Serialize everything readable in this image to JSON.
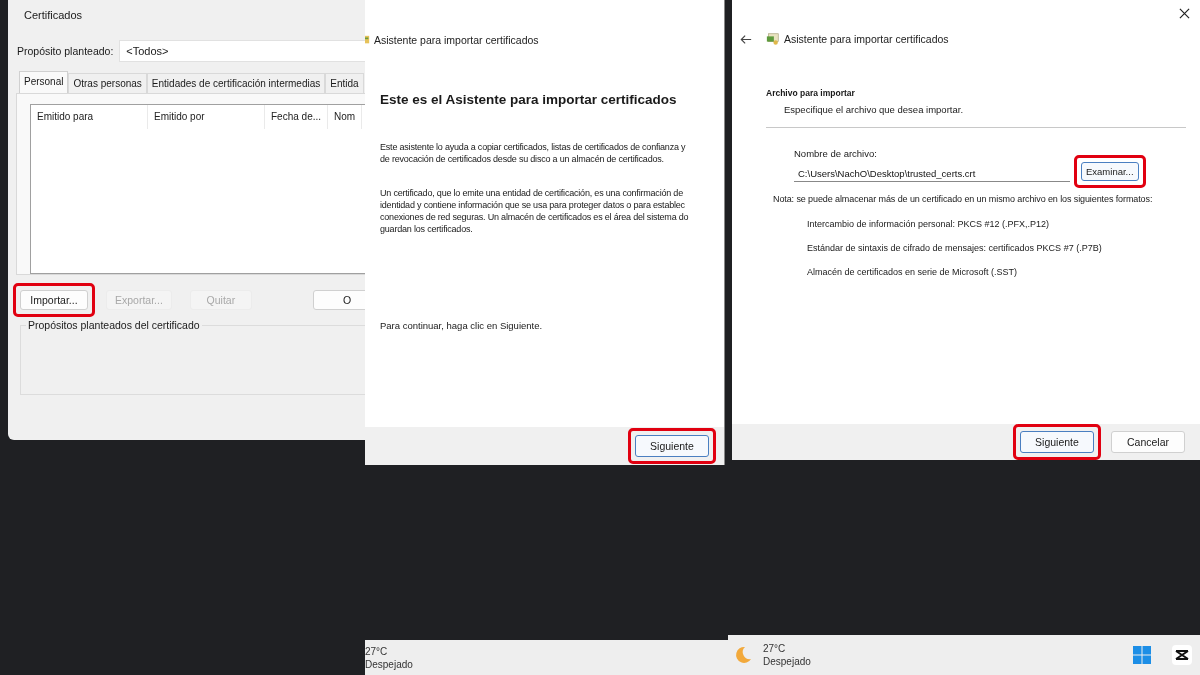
{
  "certificates_window": {
    "title": "Certificados",
    "purpose_label": "Propósito planteado:",
    "purpose_value": "<Todos>",
    "tabs": [
      {
        "label": "Personal",
        "selected": true
      },
      {
        "label": "Otras personas",
        "selected": false
      },
      {
        "label": "Entidades de certificación intermedias",
        "selected": false
      },
      {
        "label": "Entida",
        "selected": false
      }
    ],
    "columns": [
      "Emitido para",
      "Emitido por",
      "Fecha de...",
      "Nom"
    ],
    "buttons": [
      {
        "label": "Importar...",
        "disabled": false,
        "highlighted": true
      },
      {
        "label": "Exportar...",
        "disabled": true,
        "highlighted": false
      },
      {
        "label": "Quitar",
        "disabled": true,
        "highlighted": false
      },
      {
        "label": "O",
        "disabled": false,
        "highlighted": false
      }
    ],
    "group_label": "Propósitos planteados del certificado"
  },
  "welcome_wizard": {
    "title": "Asistente para importar certificados",
    "heading": "Este es el Asistente para importar certificados",
    "paragraphs": [
      [
        "Este asistente lo ayuda a copiar certificados, listas de certificados de confianza y",
        "de revocación de certificados desde su disco a un almacén de certificados."
      ],
      [
        "Un certificado, que lo emite una entidad de certificación, es una confirmación de",
        "identidad y contiene información que se usa para proteger datos o para establec",
        "conexiones de red seguras. Un almacén de certificados es el área del sistema do",
        "guardan los certificados."
      ]
    ],
    "continue_text": "Para continuar, haga clic en Siguiente.",
    "buttons": [
      {
        "label": "Siguiente",
        "highlighted": true
      }
    ],
    "taskbar": {
      "temperature": "27°C",
      "condition": "Despejado"
    }
  },
  "file_wizard": {
    "title": "Asistente para importar certificados",
    "section_title": "Archivo para importar",
    "section_subtitle": "Especifique el archivo que desea importar.",
    "field_label": "Nombre de archivo:",
    "field_value": "C:\\Users\\NachO\\Desktop\\trusted_certs.crt",
    "browse_button": {
      "label": "Examinar...",
      "highlighted": true
    },
    "note": "Nota: se puede almacenar más de un certificado en un mismo archivo en los siguientes formatos:",
    "formats": [
      "Intercambio de información personal: PKCS #12 (.PFX,.P12)",
      "Estándar de sintaxis de cifrado de mensajes: certificados PKCS #7 (.P7B)",
      "Almacén de certificados en serie de Microsoft (.SST)"
    ],
    "buttons": [
      {
        "label": "Siguiente",
        "highlighted": true
      },
      {
        "label": "Cancelar",
        "highlighted": false
      }
    ],
    "taskbar": {
      "temperature": "27°C",
      "condition": "Despejado"
    }
  }
}
